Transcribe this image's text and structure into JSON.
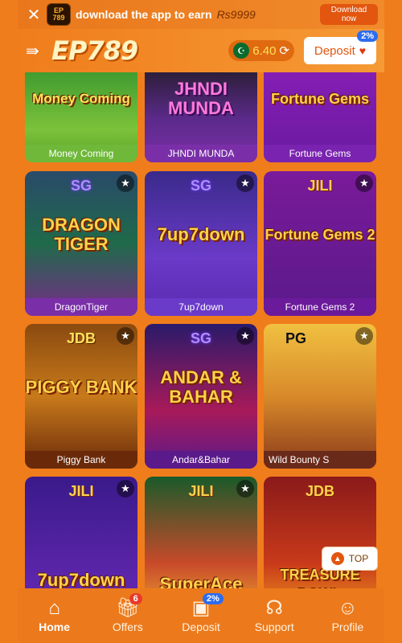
{
  "banner": {
    "close": "✕",
    "logo": "EP\n789",
    "text": "download the app to earn",
    "amount": "Rs9999",
    "button": "Download now"
  },
  "header": {
    "brand": "EP789",
    "balance": "6.40",
    "deposit_label": "Deposit",
    "deposit_badge": "2%"
  },
  "games": [
    {
      "caption": "Money Coming",
      "art_text": "Money Coming",
      "provider": ""
    },
    {
      "caption": "JHNDI MUNDA",
      "art_text": "JHNDI MUNDA",
      "provider": ""
    },
    {
      "caption": "Fortune Gems",
      "art_text": "Fortune Gems",
      "provider": ""
    },
    {
      "caption": "DragonTiger",
      "art_text": "DRAGON TIGER",
      "provider": "SG"
    },
    {
      "caption": "7up7down",
      "art_text": "7up7down",
      "provider": "SG"
    },
    {
      "caption": "Fortune Gems 2",
      "art_text": "Fortune Gems 2",
      "provider": "JILI"
    },
    {
      "caption": "Piggy Bank",
      "art_text": "PIGGY BANK",
      "provider": "JDB"
    },
    {
      "caption": "Andar&Bahar",
      "art_text": "ANDAR & BAHAR",
      "provider": "SG"
    },
    {
      "caption": "Wild Bounty S",
      "art_text": "",
      "provider": "PG"
    },
    {
      "caption": "",
      "art_text": "7up7down",
      "provider": "JILI"
    },
    {
      "caption": "",
      "art_text": "SuperAce",
      "provider": "JILI"
    },
    {
      "caption": "",
      "art_text": "TREASURE BOWL",
      "provider": "JDB"
    }
  ],
  "top_button": "TOP",
  "nav": [
    {
      "label": "Home",
      "badge": ""
    },
    {
      "label": "Offers",
      "badge": "6"
    },
    {
      "label": "Deposit",
      "badge": "2%"
    },
    {
      "label": "Support",
      "badge": ""
    },
    {
      "label": "Profile",
      "badge": ""
    }
  ],
  "colors": {
    "brand_orange": "#f07d1c",
    "accent": "#e2560f",
    "badge_blue": "#2d6cf0"
  }
}
